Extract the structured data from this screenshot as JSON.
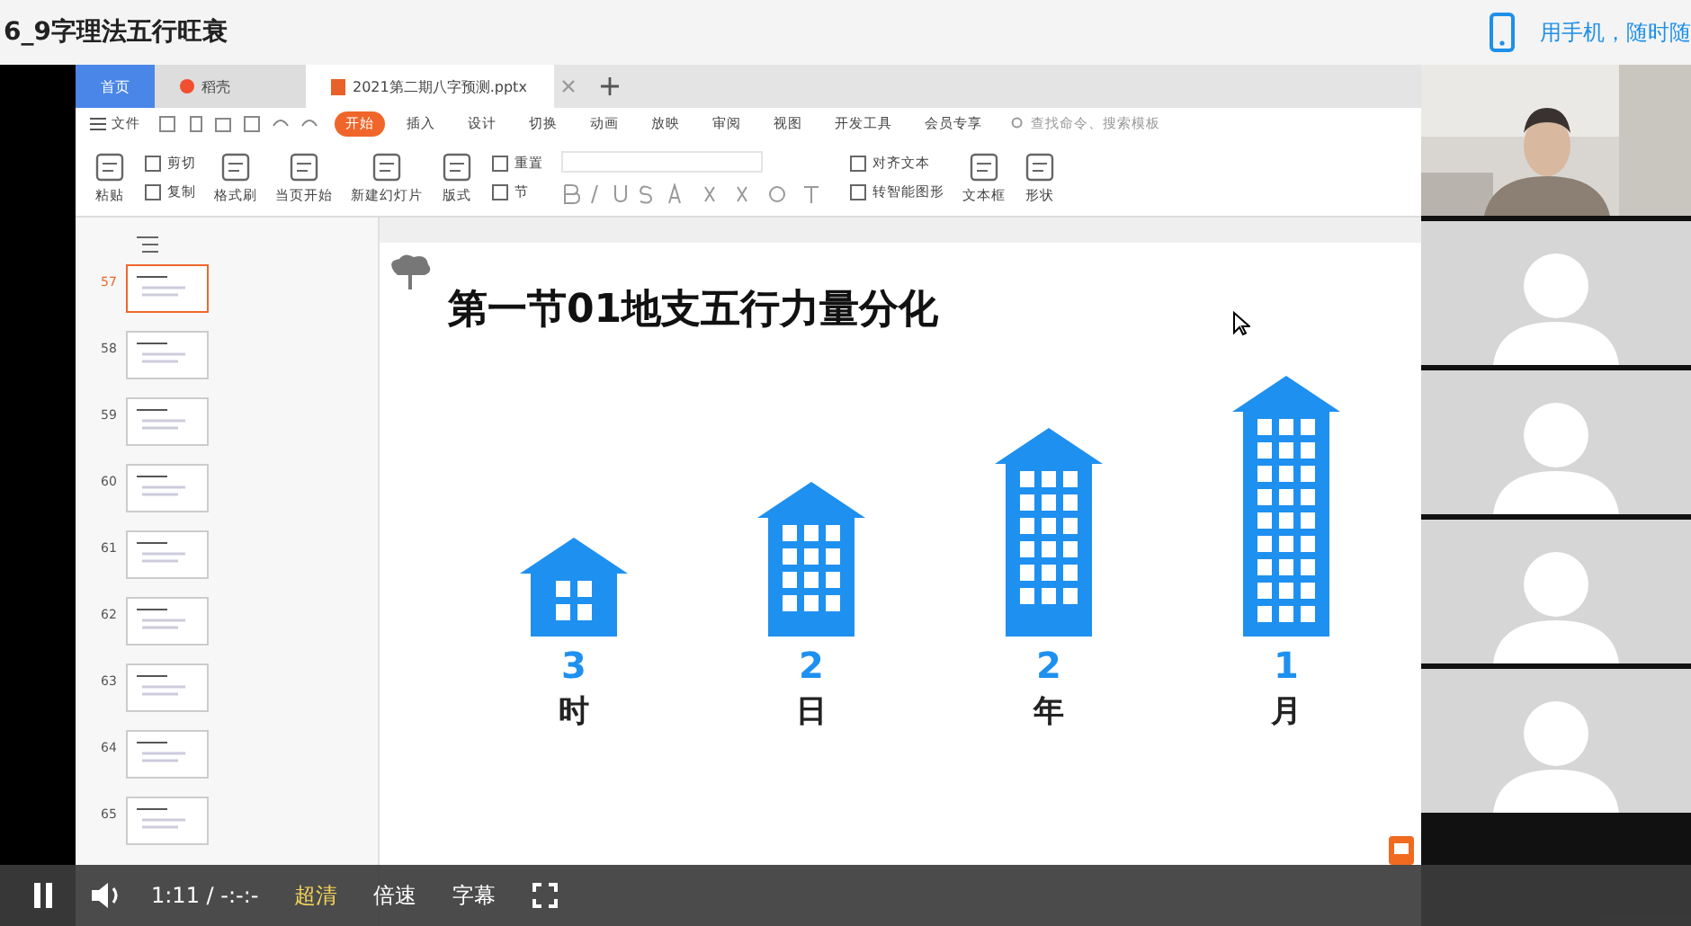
{
  "page": {
    "title": "6_9字理法五行旺衰",
    "promo": "用手机，随时随"
  },
  "tabs": [
    {
      "label": "首页",
      "kind": "home",
      "selected": false
    },
    {
      "label": "稻壳",
      "kind": "docer",
      "selected": false
    },
    {
      "label": "2021第二期八字预测.pptx",
      "kind": "doc",
      "selected": true
    }
  ],
  "menu": [
    {
      "label": "开始",
      "selected": true
    },
    {
      "label": "插入",
      "selected": false
    },
    {
      "label": "设计",
      "selected": false
    },
    {
      "label": "切换",
      "selected": false
    },
    {
      "label": "动画",
      "selected": false
    },
    {
      "label": "放映",
      "selected": false
    },
    {
      "label": "审阅",
      "selected": false
    },
    {
      "label": "视图",
      "selected": false
    },
    {
      "label": "开发工具",
      "selected": false
    },
    {
      "label": "会员专享",
      "selected": false
    }
  ],
  "file_menu": "文件",
  "search": {
    "placeholder": "查找命令、搜索模板"
  },
  "ribbon": [
    {
      "kind": "big",
      "label": "粘贴"
    },
    {
      "kind": "pair",
      "items": [
        "剪切",
        "复制"
      ]
    },
    {
      "kind": "big",
      "label": "格式刷"
    },
    {
      "kind": "big",
      "label": "当页开始"
    },
    {
      "kind": "big",
      "label": "新建幻灯片"
    },
    {
      "kind": "big",
      "label": "版式"
    },
    {
      "kind": "pair",
      "items": [
        "重置",
        "节"
      ]
    },
    {
      "kind": "font"
    },
    {
      "kind": "pair",
      "items": [
        "对齐文本",
        "转智能图形"
      ]
    },
    {
      "kind": "big",
      "label": "文本框"
    },
    {
      "kind": "big",
      "label": "形状"
    }
  ],
  "thumbnails": [
    {
      "number": "57",
      "selected": true
    },
    {
      "number": "58",
      "selected": false
    },
    {
      "number": "59",
      "selected": false
    },
    {
      "number": "60",
      "selected": false
    },
    {
      "number": "61",
      "selected": false
    },
    {
      "number": "62",
      "selected": false
    },
    {
      "number": "63",
      "selected": false
    },
    {
      "number": "64",
      "selected": false
    },
    {
      "number": "65",
      "selected": false
    }
  ],
  "slide": {
    "title": "第一节01地支五行力量分化",
    "buildings": [
      {
        "value": "3",
        "label": "时",
        "kind": "house"
      },
      {
        "value": "2",
        "label": "日",
        "kind": "lowrise"
      },
      {
        "value": "2",
        "label": "年",
        "kind": "midrise"
      },
      {
        "value": "1",
        "label": "月",
        "kind": "highrise"
      }
    ]
  },
  "player": {
    "playing": true,
    "time": "1:11 / -:-:-",
    "quality": "超清",
    "speed": "倍速",
    "subtitles": "字幕"
  }
}
